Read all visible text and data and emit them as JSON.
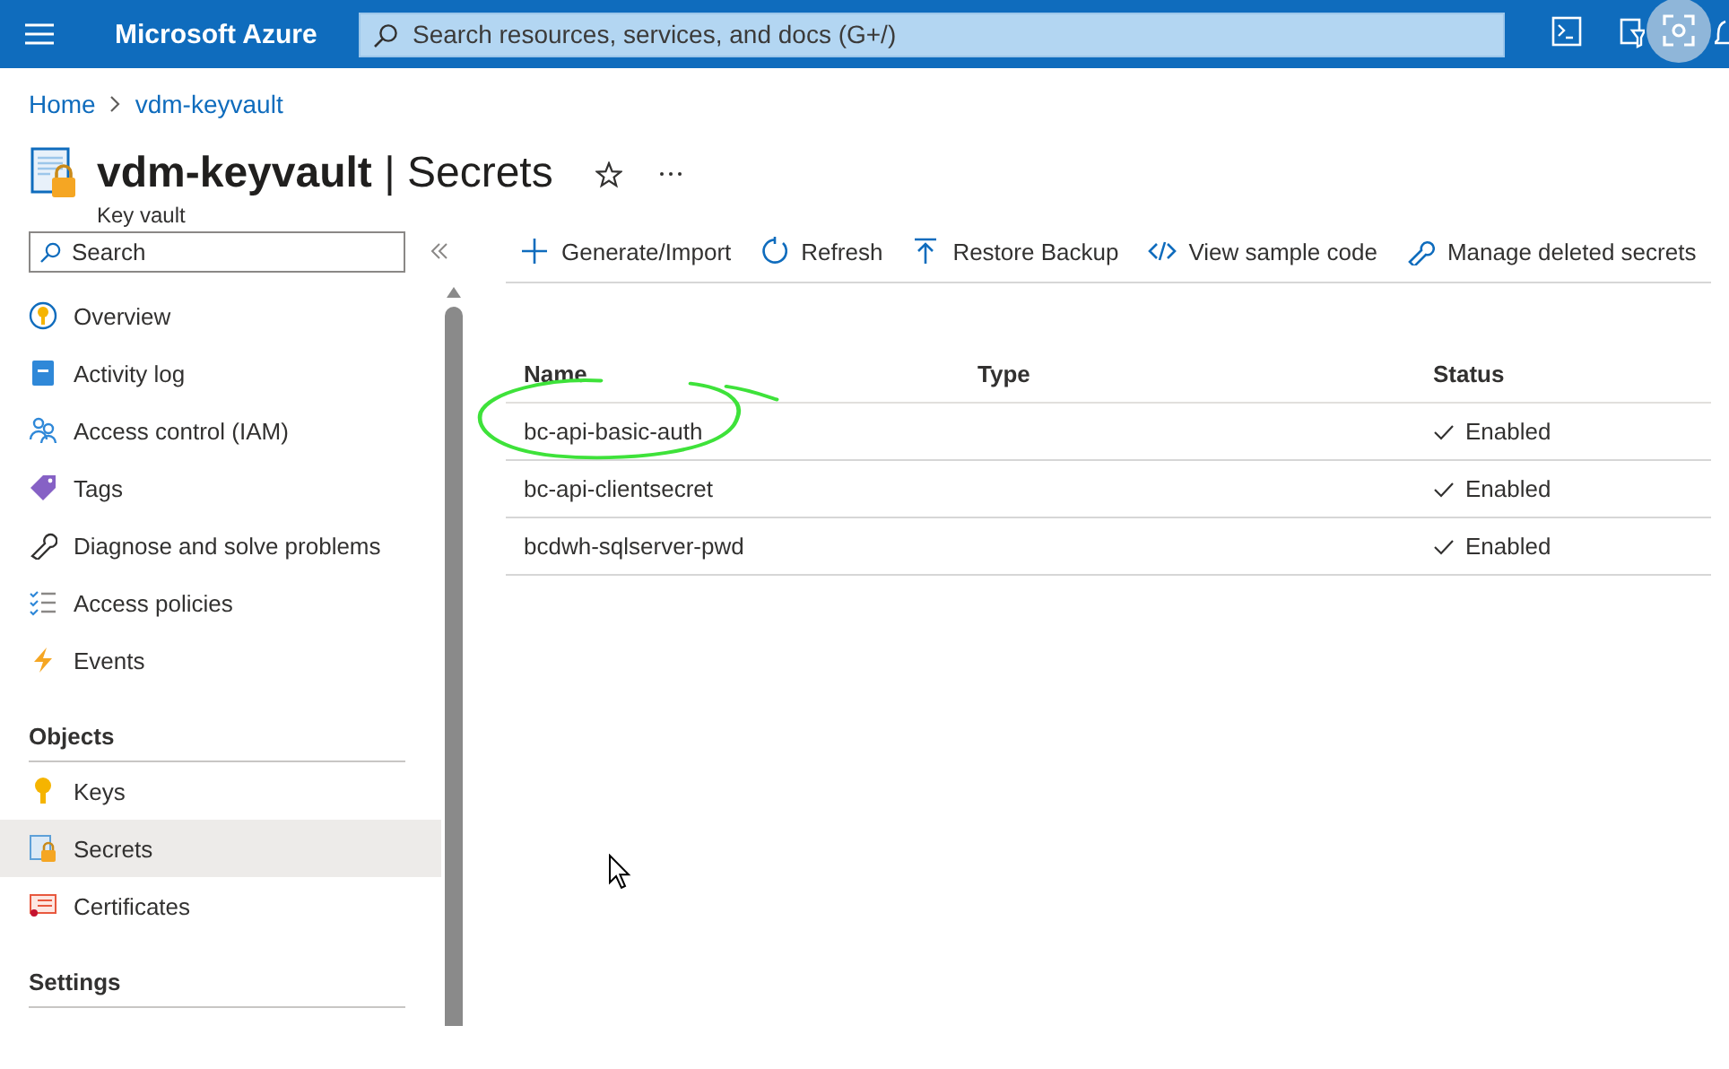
{
  "top_bar": {
    "brand": "Microsoft Azure",
    "search": {
      "placeholder": "Search resources, services, and docs (G+/)"
    }
  },
  "breadcrumb": [
    "Home",
    "vdm-keyvault"
  ],
  "header": {
    "title": "**vdm-keyvault** | Secrets",
    "subtitle": "Key vault"
  },
  "sidebar": {
    "search": {
      "placeholder": "Search"
    },
    "sections": [
      {
        "items": [
          {
            "label": "Overview",
            "selected": false
          },
          {
            "label": "Activity log",
            "selected": false
          },
          {
            "label": "Access control (IAM)",
            "selected": false
          },
          {
            "label": "Tags",
            "selected": false
          },
          {
            "label": "Diagnose and solve problems",
            "selected": false
          },
          {
            "label": "Access policies",
            "selected": false
          },
          {
            "label": "Events",
            "selected": false
          }
        ]
      },
      {
        "heading": "Objects",
        "items": [
          {
            "label": "Keys",
            "selected": false
          },
          {
            "label": "Secrets",
            "selected": true
          },
          {
            "label": "Certificates",
            "selected": false
          }
        ]
      },
      {
        "heading": "Settings"
      }
    ]
  },
  "toolbar": [
    "Generate/Import",
    "Refresh",
    "Restore Backup",
    "View sample code",
    "Manage deleted secrets"
  ],
  "table": {
    "columns": [
      "Name",
      "Type",
      "Status"
    ],
    "rows": [
      {
        "name": "bc-api-basic-auth",
        "status": "Enabled"
      },
      {
        "name": "bc-api-clientsecret",
        "status": "Enabled"
      },
      {
        "name": "bcdwh-sqlserver-pwd",
        "status": "Enabled"
      }
    ]
  }
}
